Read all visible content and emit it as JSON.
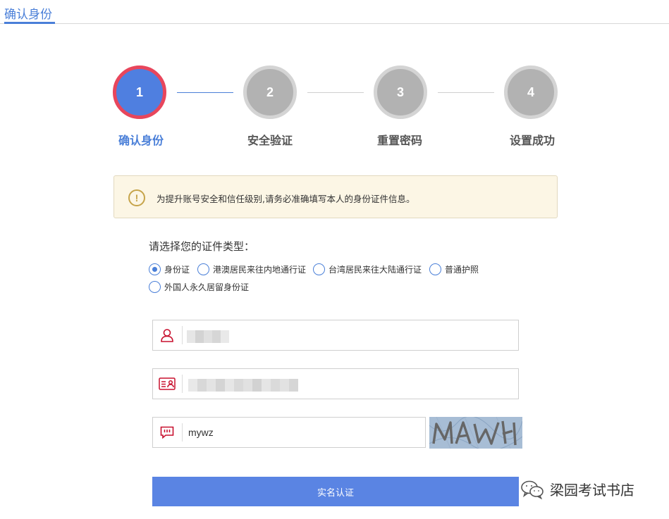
{
  "tab": {
    "title": "确认身份"
  },
  "steps": [
    {
      "number": "1",
      "label": "确认身份",
      "state": "active"
    },
    {
      "number": "2",
      "label": "安全验证",
      "state": "inactive"
    },
    {
      "number": "3",
      "label": "重置密码",
      "state": "inactive"
    },
    {
      "number": "4",
      "label": "设置成功",
      "state": "inactive"
    }
  ],
  "notice": {
    "icon": "exclamation-circle-icon",
    "text": "为提升账号安全和信任级别,请务必准确填写本人的身份证件信息。"
  },
  "id_type": {
    "label": "请选择您的证件类型：",
    "options": [
      {
        "label": "身份证",
        "checked": true
      },
      {
        "label": "港澳居民来往内地通行证",
        "checked": false
      },
      {
        "label": "台湾居民来往大陆通行证",
        "checked": false
      },
      {
        "label": "普通护照",
        "checked": false
      },
      {
        "label": "外国人永久居留身份证",
        "checked": false
      }
    ]
  },
  "fields": {
    "name": {
      "icon": "user-icon",
      "value": ""
    },
    "id_number": {
      "icon": "id-card-icon",
      "value": ""
    },
    "captcha": {
      "icon": "message-icon",
      "value": "mywz"
    }
  },
  "submit": {
    "label": "实名认证"
  },
  "watermark": {
    "text": "梁园考试书店"
  },
  "colors": {
    "accent": "#4a7fd8",
    "active_ring": "#e8465c",
    "icon_red": "#c8102e",
    "notice_bg": "#fcf6e5"
  }
}
